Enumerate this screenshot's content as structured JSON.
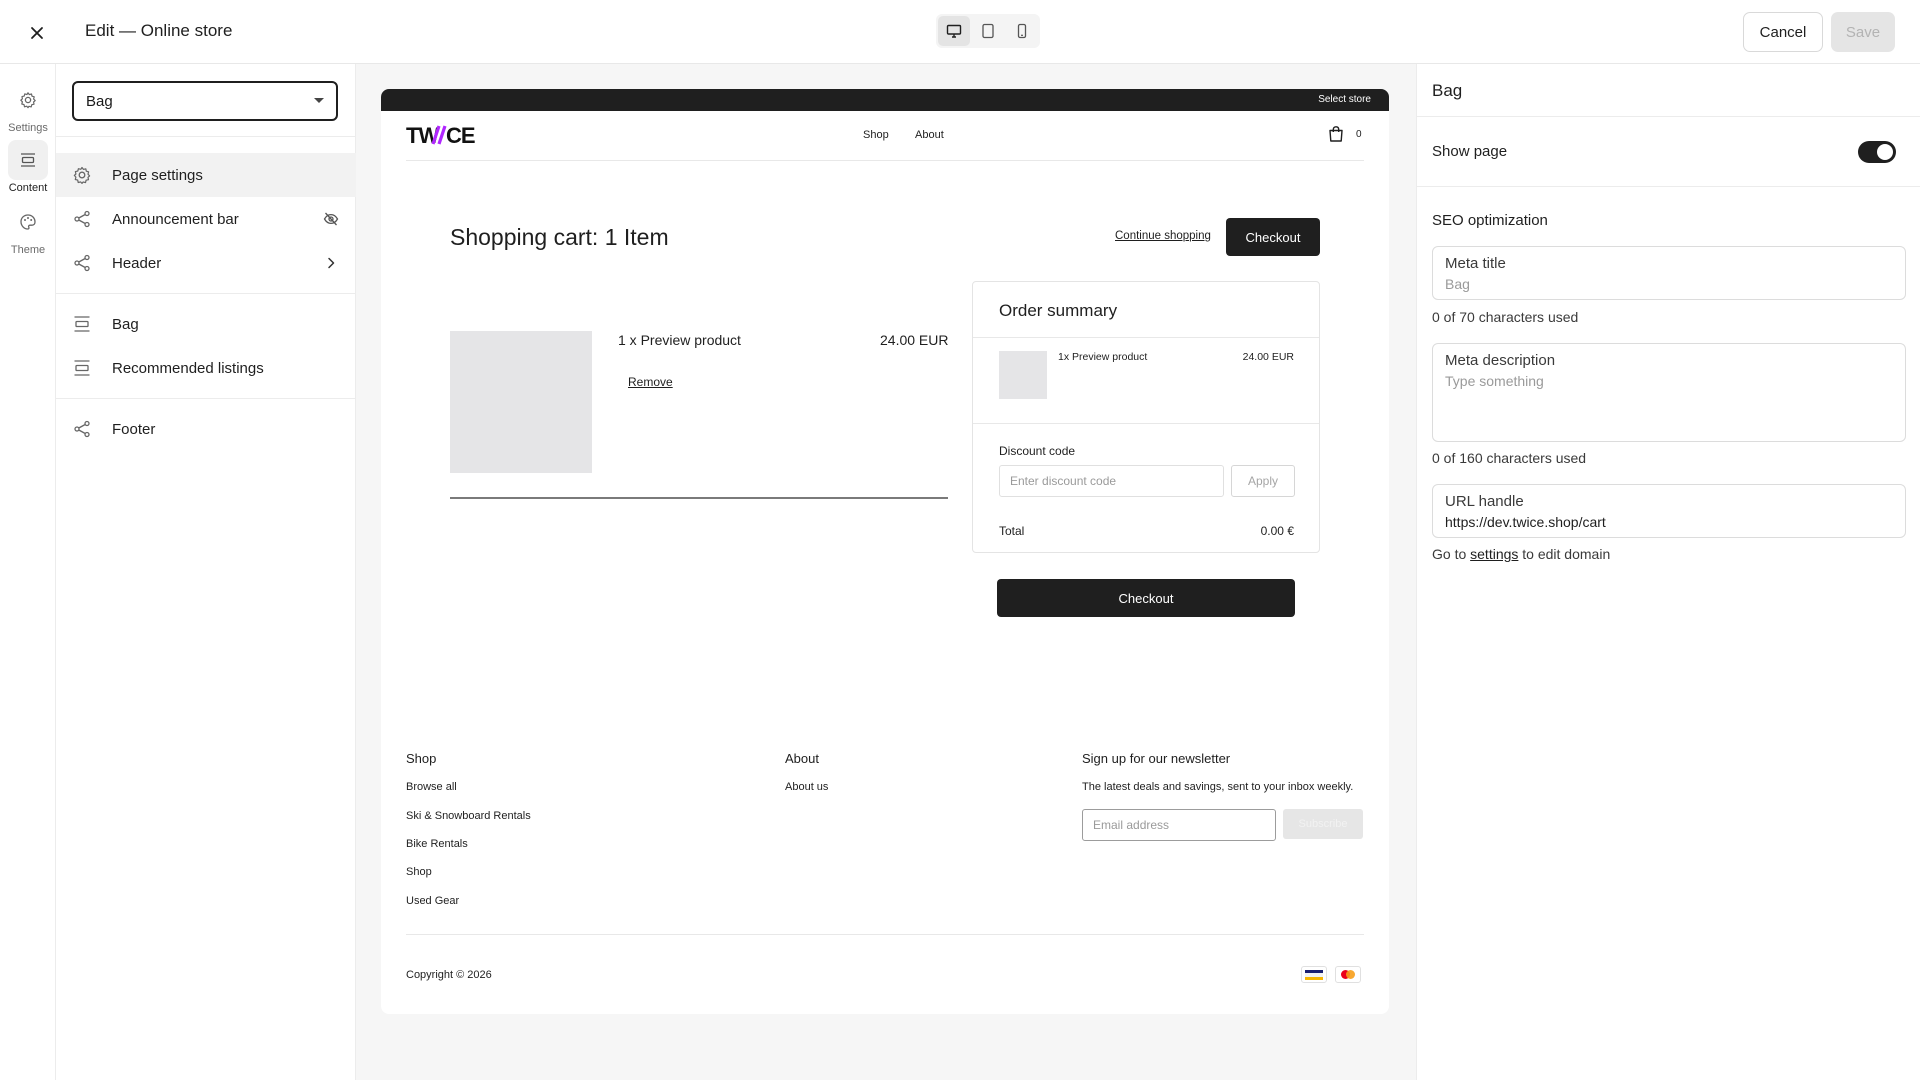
{
  "topbar": {
    "title": "Edit — Online store",
    "cancel_label": "Cancel",
    "save_label": "Save"
  },
  "rail": {
    "items": [
      {
        "label": "Settings",
        "icon": "gear-icon"
      },
      {
        "label": "Content",
        "icon": "sections-icon",
        "active": true
      },
      {
        "label": "Theme",
        "icon": "palette-icon"
      }
    ]
  },
  "sections": {
    "page_select": "Bag",
    "items": [
      {
        "label": "Page settings",
        "icon": "gear-icon",
        "active": true
      },
      {
        "label": "Announcement bar",
        "icon": "share-icon",
        "trailing": "eye-off-icon"
      },
      {
        "label": "Header",
        "icon": "share-icon",
        "trailing": "chevron-right-icon"
      },
      {
        "label": "Bag",
        "icon": "section-icon"
      },
      {
        "label": "Recommended listings",
        "icon": "section-icon"
      },
      {
        "label": "Footer",
        "icon": "share-icon"
      }
    ]
  },
  "store": {
    "top_bar_text": "Select store",
    "logo": "TWICE",
    "logo_accent": "#b026ff",
    "nav": [
      "Shop",
      "About"
    ],
    "bag_count": "0",
    "cart_title": "Shopping cart: 1 Item",
    "continue_shopping": "Continue shopping",
    "checkout_label": "Checkout",
    "product": {
      "name": "1 x Preview product",
      "price": "24.00 EUR",
      "remove_label": "Remove"
    },
    "summary": {
      "title": "Order summary",
      "item_name": "1x Preview product",
      "item_price": "24.00 EUR",
      "discount_label": "Discount code",
      "discount_placeholder": "Enter discount code",
      "apply_label": "Apply",
      "total_label": "Total",
      "total_value": "0.00 €"
    },
    "footer": {
      "shop_heading": "Shop",
      "shop_links": [
        "Browse all",
        "Ski & Snowboard Rentals",
        "Bike Rentals",
        "Shop",
        "Used Gear"
      ],
      "about_heading": "About",
      "about_links": [
        "About us"
      ],
      "newsletter_heading": "Sign up for our newsletter",
      "newsletter_text": "The latest deals and savings, sent to your inbox weekly.",
      "email_placeholder": "Email address",
      "subscribe_label": "Subscribe",
      "copyright": "Copyright © 2026",
      "payment_icons": [
        "visa-icon",
        "mastercard-icon"
      ]
    }
  },
  "settings": {
    "title": "Bag",
    "show_page_label": "Show page",
    "show_page_on": true,
    "seo_title": "SEO optimization",
    "meta_title_label": "Meta title",
    "meta_title_placeholder": "Bag",
    "meta_title_hint": "0 of 70 characters used",
    "meta_desc_label": "Meta description",
    "meta_desc_placeholder": "Type something",
    "meta_desc_hint": "0 of 160 characters used",
    "url_label": "URL handle",
    "url_value": "https://dev.twice.shop/cart",
    "domain_hint_prefix": "Go to",
    "domain_hint_link": "settings",
    "domain_hint_suffix": "to edit domain"
  }
}
